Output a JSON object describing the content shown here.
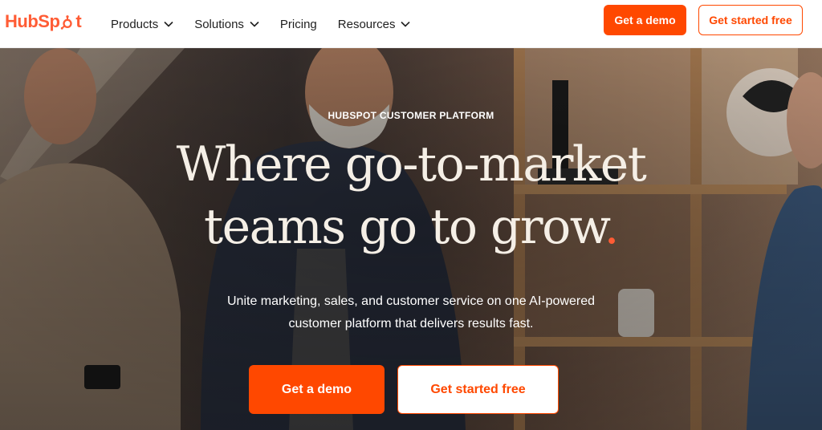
{
  "brand": {
    "logo_text_left": "HubSp",
    "logo_text_right": "t",
    "accent_color": "#ff4800",
    "logo_color": "#ff5c35"
  },
  "nav": {
    "items": [
      {
        "label": "Products",
        "has_dropdown": true
      },
      {
        "label": "Solutions",
        "has_dropdown": true
      },
      {
        "label": "Pricing",
        "has_dropdown": false
      },
      {
        "label": "Resources",
        "has_dropdown": true
      }
    ],
    "demo_label": "Get a demo",
    "started_label": "Get started free"
  },
  "hero": {
    "eyebrow": "HUBSPOT CUSTOMER PLATFORM",
    "headline_line1": "Where go-to-market",
    "headline_line2": "teams go to grow",
    "headline_dot": ".",
    "subcopy_line1": "Unite marketing, sales, and customer service on one AI-powered",
    "subcopy_line2": "customer platform that delivers results fast.",
    "demo_label": "Get a demo",
    "started_label": "Get started free"
  },
  "icons": {
    "chevron": "chevron-down-icon",
    "sprocket": "hubspot-sprocket-icon"
  }
}
